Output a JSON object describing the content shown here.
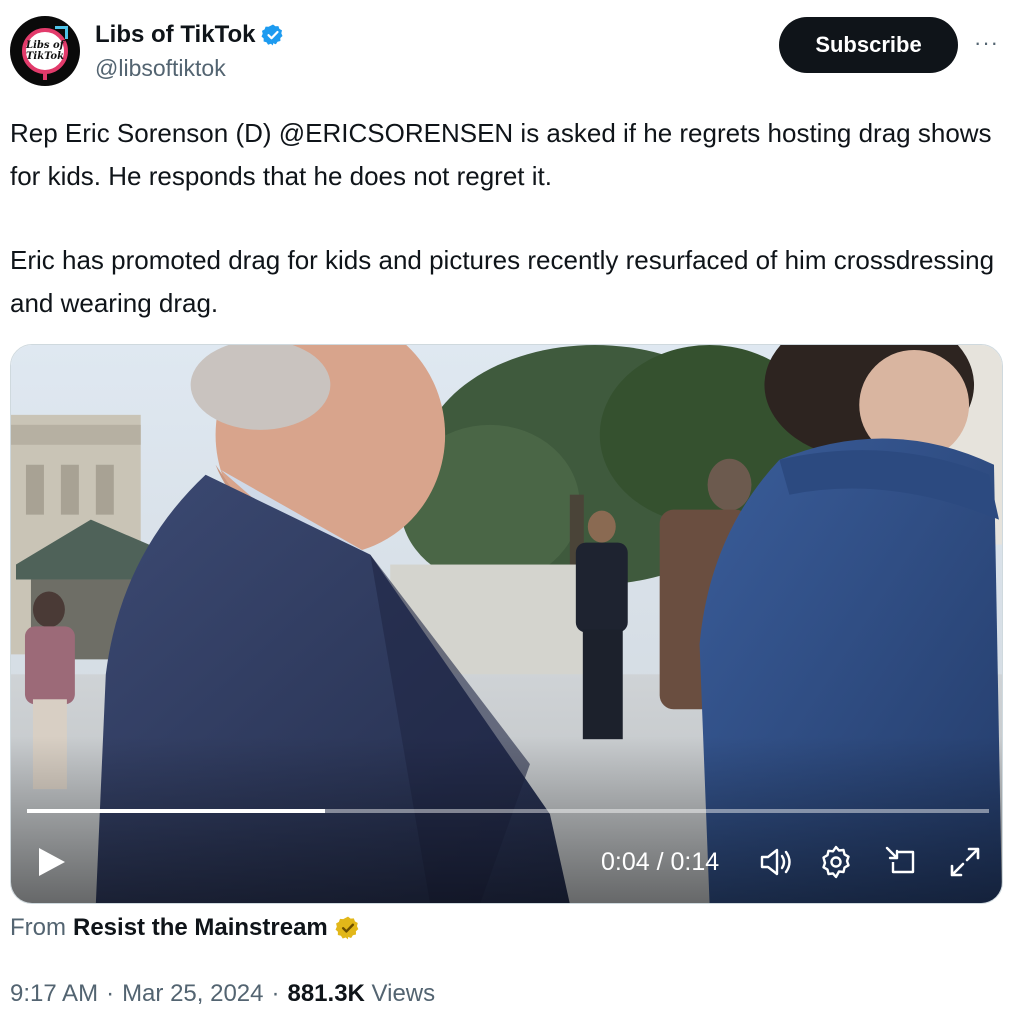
{
  "author": {
    "display_name": "Libs of TikTok",
    "handle": "@libsoftiktok",
    "avatar_text_line1": "Libs of",
    "avatar_text_line2": "TikTok",
    "verified_color": "#1d9bf0"
  },
  "header": {
    "subscribe_label": "Subscribe",
    "more_label": "···"
  },
  "tweet": {
    "paragraph1": "Rep Eric Sorenson (D) @ERICSORENSEN is asked if he regrets hosting drag shows for kids. He responds that he does not regret it.",
    "paragraph2": "Eric has promoted drag for kids and pictures recently resurfaced of him crossdressing and wearing drag."
  },
  "video": {
    "time_display": "0:04 / 0:14",
    "progress_fraction": 0.31,
    "icons": [
      "play-icon",
      "volume-icon",
      "settings-icon",
      "picture-in-picture-icon",
      "fullscreen-icon"
    ]
  },
  "source": {
    "prefix": "From",
    "name": "Resist the Mainstream",
    "badge_color": "#e2b719"
  },
  "meta": {
    "time": "9:17 AM",
    "sep1": "·",
    "date": "Mar 25, 2024",
    "sep2": "·",
    "views_count": "881.3K",
    "views_label": "Views"
  }
}
